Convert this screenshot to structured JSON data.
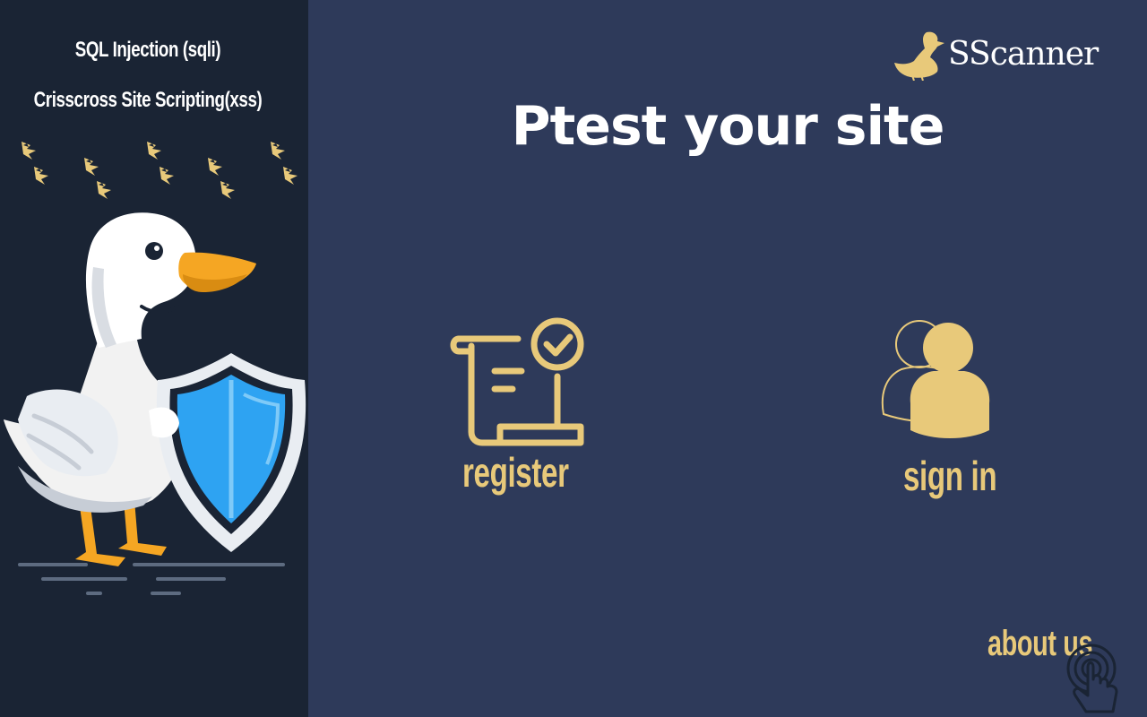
{
  "sidebar": {
    "topics": [
      {
        "label": "SQL Injection (sqli)"
      },
      {
        "label": "Crisscross Site Scripting(xss)"
      }
    ],
    "illustration": "duck-with-shield-icon"
  },
  "brand": {
    "name": "SScanner",
    "logo_icon": "duck-icon"
  },
  "hero": {
    "title": "Ptest your site"
  },
  "actions": {
    "register": {
      "label": "register",
      "icon": "document-check-icon"
    },
    "sign_in": {
      "label": "sign in",
      "icon": "users-icon"
    },
    "about": {
      "label": "about us",
      "icon": "pointer-hand-icon"
    }
  },
  "colors": {
    "background": "#2e3a5a",
    "sidebar": "#1a2434",
    "accent": "#e8c97a",
    "title": "#ffffff",
    "shield": "#2ea3f2"
  }
}
